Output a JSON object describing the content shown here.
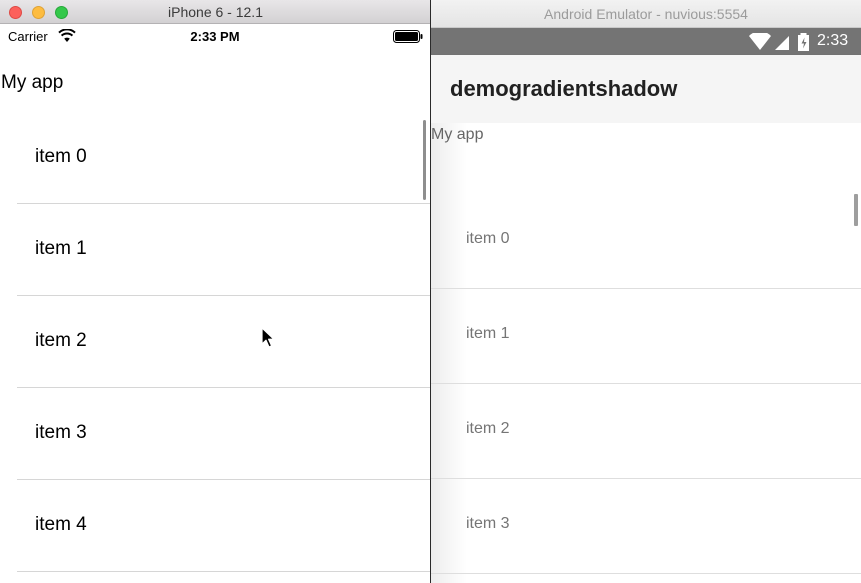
{
  "ios": {
    "window_title": "iPhone 6 - 12.1",
    "status": {
      "carrier": "Carrier",
      "time": "2:33 PM"
    },
    "app_title": "My app",
    "items": [
      {
        "label": "item 0"
      },
      {
        "label": "item 1"
      },
      {
        "label": "item 2"
      },
      {
        "label": "item 3"
      },
      {
        "label": "item 4"
      }
    ]
  },
  "android": {
    "window_title": "Android Emulator - nuvious:5554",
    "status": {
      "time": "2:33"
    },
    "appbar_title": "demogradientshadow",
    "app_label": "My app",
    "items": [
      {
        "label": "item 0"
      },
      {
        "label": "item 1"
      },
      {
        "label": "item 2"
      },
      {
        "label": "item 3"
      }
    ]
  },
  "icons": {
    "ios_status": [
      "wifi-icon",
      "battery-icon"
    ],
    "android_status": [
      "wifi-icon",
      "cell-signal-icon",
      "battery-icon"
    ],
    "pointer": "cursor-icon"
  },
  "colors": {
    "traffic_red": "#fc605b",
    "traffic_yellow": "#fdbc40",
    "traffic_green": "#34c84a",
    "android_statusbar": "#747474",
    "android_appbar": "#f5f5f5"
  }
}
